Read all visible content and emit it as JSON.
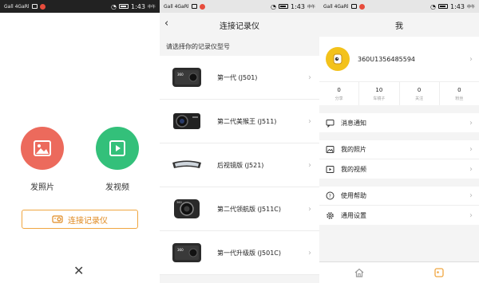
{
  "status_bars": [
    {
      "signal": "Gall 4GaRl",
      "time": "1:43",
      "ampm": "中午"
    },
    {
      "signal": "Gall 4GaRl",
      "time": "1:43",
      "ampm": "中午"
    },
    {
      "signal": "Gall 4GaRl",
      "time": "1:43",
      "ampm": "中午"
    }
  ],
  "capture_screen": {
    "photo_label": "发照片",
    "video_label": "发视频",
    "connect_label": "连接记录仪",
    "close_symbol": "✕"
  },
  "connect_screen": {
    "title": "连接记录仪",
    "back_symbol": "‹",
    "prompt": "请选择你的记录仪型号",
    "models": [
      {
        "name": "第一代 (J501)",
        "icon": "dashcam-j501-icon"
      },
      {
        "name": "第二代美猴王 (J511)",
        "icon": "dashcam-j511-icon"
      },
      {
        "name": "后视镜版 (J521)",
        "icon": "mirror-dashcam-icon"
      },
      {
        "name": "第二代领航版 (J511C)",
        "icon": "dashcam-j511c-icon"
      },
      {
        "name": "第一代升级版 (J501C)",
        "icon": "dashcam-j501c-icon"
      }
    ]
  },
  "me_screen": {
    "title": "我",
    "username": "360U1356485594",
    "stats": [
      {
        "count": "0",
        "label": "分享"
      },
      {
        "count": "10",
        "label": "车镜子"
      },
      {
        "count": "0",
        "label": "关注"
      },
      {
        "count": "0",
        "label": "粉丝"
      }
    ],
    "menu_groups": [
      [
        {
          "label": "消息通知",
          "icon": "message-icon"
        }
      ],
      [
        {
          "label": "我的照片",
          "icon": "photo-icon"
        },
        {
          "label": "我的视频",
          "icon": "video-icon"
        }
      ],
      [
        {
          "label": "使用帮助",
          "icon": "help-icon"
        },
        {
          "label": "通用设置",
          "icon": "settings-icon"
        }
      ]
    ],
    "tabs": [
      {
        "icon": "home-icon"
      },
      {
        "icon": "me-icon"
      }
    ],
    "accent": "#f0a640"
  },
  "colors": {
    "photo_button": "#ec6a5c",
    "video_button": "#33c07a",
    "connect_border": "#f0a640"
  }
}
